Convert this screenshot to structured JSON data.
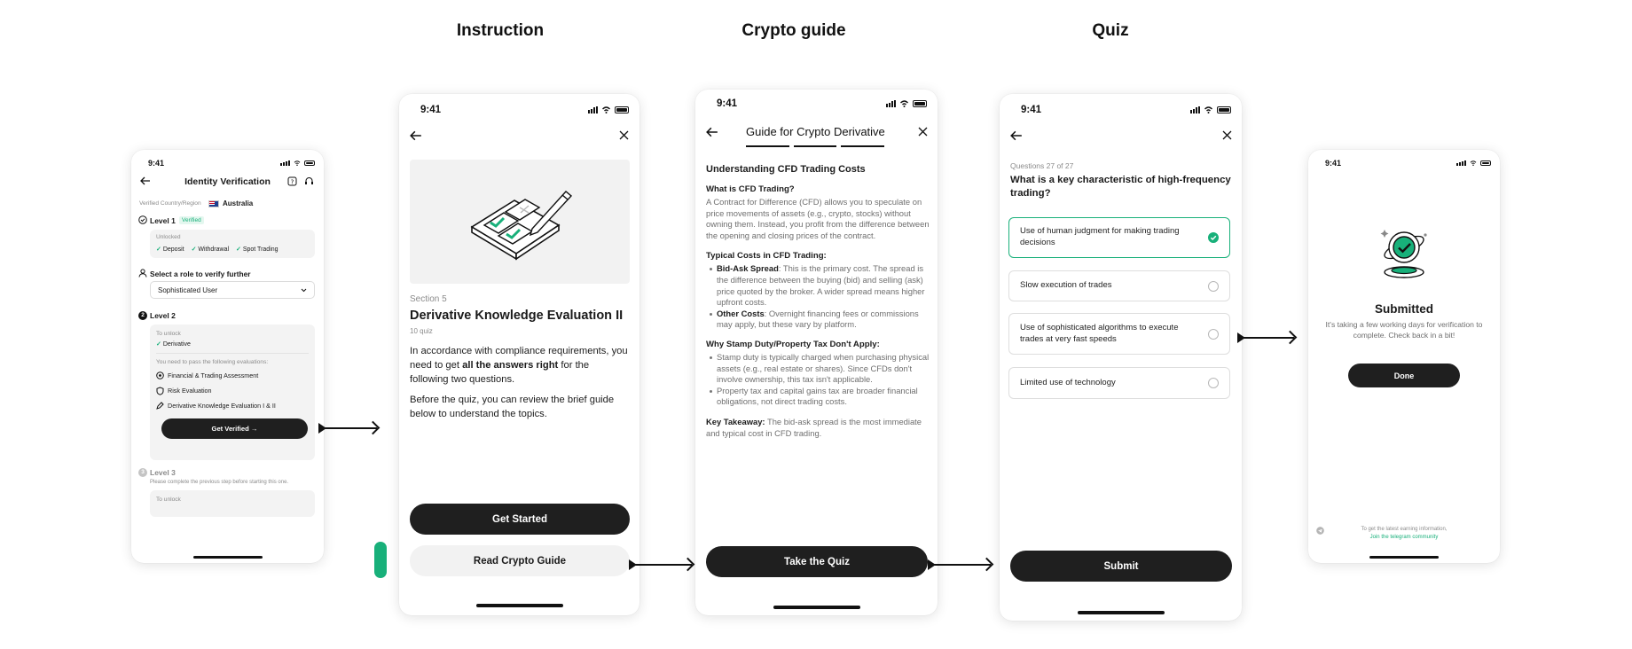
{
  "section_titles": [
    "Instruction",
    "Crypto guide",
    "Quiz"
  ],
  "colors": {
    "accent": "#18b07a",
    "dark": "#1f1f1f",
    "light_button": "#f2f2f2"
  },
  "status_time": "9:41",
  "identity": {
    "title": "Identity Verification",
    "country_label": "Verified Country/Region",
    "country": "Australia",
    "level1": {
      "title": "Level 1",
      "badge": "Verified",
      "unlocked": "Unlocked",
      "items": [
        "Deposit",
        "Withdrawal",
        "Spot Trading"
      ]
    },
    "role_prompt": "Select a role to verify further",
    "role_value": "Sophisticated User",
    "level2": {
      "title": "Level 2",
      "number": "2",
      "to_unlock": "To unlock",
      "unlock_item": "Derivative",
      "need_pass": "You need to pass the following evaluations:",
      "evaluations": [
        "Financial & Trading Assessment",
        "Risk Evaluation",
        "Derivative Knowledge Evaluation I & II"
      ],
      "cta": "Get Verified →"
    },
    "level3": {
      "title": "Level 3",
      "number": "3",
      "note": "Please complete the previous step before starting this one.",
      "to_unlock": "To unlock"
    }
  },
  "instruction": {
    "section": "Section 5",
    "title": "Derivative Knowledge Evaluation II",
    "count": "10 quiz",
    "para1_pre": "In accordance with compliance requirements, you need to get ",
    "para1_bold": "all the answers right",
    "para1_post": " for the following two questions.",
    "para2": "Before the quiz, you can review the brief guide below to understand the topics.",
    "primary_button": "Get Started",
    "secondary_button": "Read Crypto Guide"
  },
  "guide": {
    "title": "Guide for Crypto Derivative",
    "heading": "Understanding CFD Trading Costs",
    "q1": "What is CFD Trading?",
    "q1_body": "A Contract for Difference (CFD) allows you to speculate on price movements of assets (e.g., crypto, stocks) without owning them. Instead, you profit from the difference between the opening and closing prices of the contract.",
    "q2": "Typical Costs in CFD Trading:",
    "bullets_costs": [
      {
        "bold": "Bid-Ask Spread",
        "text": ": This is the primary cost. The spread is the difference between the buying (bid) and selling (ask) price quoted by the broker. A wider spread means higher upfront costs."
      },
      {
        "bold": "Other Costs",
        "text": ": Overnight financing fees or commissions may apply, but these vary by platform."
      }
    ],
    "q3": "Why Stamp Duty/Property Tax Don't Apply:",
    "bullets_tax": [
      "Stamp duty is typically charged when purchasing physical assets (e.g., real estate or shares). Since CFDs don't involve ownership, this tax isn't applicable.",
      "Property tax and capital gains tax are broader financial obligations, not direct trading costs."
    ],
    "takeaway_label": "Key Takeaway:",
    "takeaway_text": " The bid-ask spread is the most immediate and typical cost in CFD trading.",
    "button": "Take the Quiz"
  },
  "quiz": {
    "progress": "Questions 27 of 27",
    "question": "What is a key characteristic of high-frequency trading?",
    "options": [
      {
        "label": "Use of human judgment for making trading decisions",
        "selected": true
      },
      {
        "label": "Slow execution of trades",
        "selected": false
      },
      {
        "label": "Use of sophisticated algorithms to execute trades at very fast speeds",
        "selected": false
      },
      {
        "label": "Limited use of technology",
        "selected": false
      }
    ],
    "submit": "Submit"
  },
  "submitted": {
    "title": "Submitted",
    "message": "It's taking a few working days for verification to complete. Check back in a bit!",
    "button": "Done",
    "footer_text": "To get the latest earning information,",
    "footer_link": "Join the telegram community"
  }
}
